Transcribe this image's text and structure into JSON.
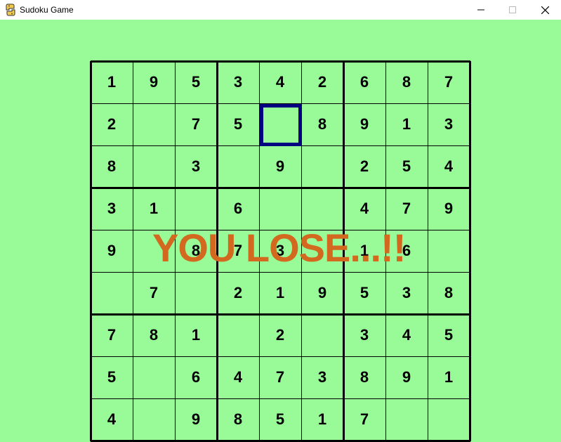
{
  "window": {
    "title": "Sudoku Game",
    "icon": "python-snake-icon"
  },
  "colors": {
    "background": "#98fb98",
    "grid": "#000000",
    "selection": "#000080",
    "message": "#d2691e"
  },
  "board": {
    "rows": [
      [
        "1",
        "9",
        "5",
        "3",
        "4",
        "2",
        "6",
        "8",
        "7"
      ],
      [
        "2",
        "",
        "7",
        "5",
        "",
        "8",
        "9",
        "1",
        "3"
      ],
      [
        "8",
        "",
        "3",
        "",
        "9",
        "",
        "2",
        "5",
        "4"
      ],
      [
        "3",
        "1",
        "",
        "6",
        "",
        "",
        "4",
        "7",
        "9"
      ],
      [
        "9",
        "",
        "8",
        "7",
        "3",
        "",
        "1",
        "6",
        ""
      ],
      [
        "",
        "7",
        "",
        "2",
        "1",
        "9",
        "5",
        "3",
        "8"
      ],
      [
        "7",
        "8",
        "1",
        "",
        "2",
        "",
        "3",
        "4",
        "5"
      ],
      [
        "5",
        "",
        "6",
        "4",
        "7",
        "3",
        "8",
        "9",
        "1"
      ],
      [
        "4",
        "",
        "9",
        "8",
        "5",
        "1",
        "7",
        "",
        ""
      ]
    ],
    "selected_cell": {
      "row": 2,
      "col": 5
    }
  },
  "message": "YOU LOSE...!!"
}
